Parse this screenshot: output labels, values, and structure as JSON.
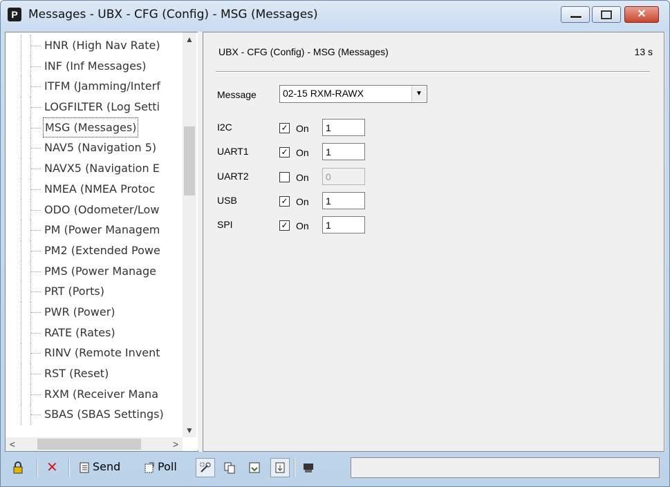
{
  "window": {
    "title": "Messages - UBX - CFG (Config) - MSG (Messages)",
    "app_icon_letter": "P",
    "close_glyph": "✕"
  },
  "tree": {
    "items": [
      {
        "label": "HNR (High Nav Rate)",
        "selected": false
      },
      {
        "label": "INF (Inf Messages)",
        "selected": false
      },
      {
        "label": "ITFM (Jamming/Interf",
        "selected": false
      },
      {
        "label": "LOGFILTER (Log Setti",
        "selected": false
      },
      {
        "label": "MSG (Messages)",
        "selected": true
      },
      {
        "label": "NAV5 (Navigation 5)",
        "selected": false
      },
      {
        "label": "NAVX5 (Navigation E",
        "selected": false
      },
      {
        "label": "NMEA (NMEA Protoc",
        "selected": false
      },
      {
        "label": "ODO (Odometer/Low",
        "selected": false
      },
      {
        "label": "PM (Power Managem",
        "selected": false
      },
      {
        "label": "PM2 (Extended Powe",
        "selected": false
      },
      {
        "label": "PMS (Power Manage",
        "selected": false
      },
      {
        "label": "PRT (Ports)",
        "selected": false
      },
      {
        "label": "PWR (Power)",
        "selected": false
      },
      {
        "label": "RATE (Rates)",
        "selected": false
      },
      {
        "label": "RINV (Remote Invent",
        "selected": false
      },
      {
        "label": "RST (Reset)",
        "selected": false
      },
      {
        "label": "RXM (Receiver Mana",
        "selected": false
      },
      {
        "label": "SBAS (SBAS Settings)",
        "selected": false
      }
    ],
    "scroll_up": "▲",
    "scroll_down": "▼",
    "scroll_left": "<",
    "scroll_right": ">"
  },
  "content": {
    "header": "UBX - CFG (Config) - MSG (Messages)",
    "elapsed": "13 s",
    "message_label": "Message",
    "message_value": "02-15 RXM-RAWX",
    "dropdown_glyph": "▼",
    "ports": [
      {
        "name": "I2C",
        "checked": true,
        "on_label": "On",
        "rate": "1",
        "enabled": true
      },
      {
        "name": "UART1",
        "checked": true,
        "on_label": "On",
        "rate": "1",
        "enabled": true
      },
      {
        "name": "UART2",
        "checked": false,
        "on_label": "On",
        "rate": "0",
        "enabled": false
      },
      {
        "name": "USB",
        "checked": true,
        "on_label": "On",
        "rate": "1",
        "enabled": true
      },
      {
        "name": "SPI",
        "checked": true,
        "on_label": "On",
        "rate": "1",
        "enabled": true
      }
    ],
    "check_glyph": "✓"
  },
  "toolbar": {
    "send_label": "Send",
    "poll_label": "Poll",
    "lock_icon": "lock-icon",
    "delete_glyph": "✕",
    "accent_lock": "#e8b400",
    "accent_delete": "#d41a1a"
  }
}
